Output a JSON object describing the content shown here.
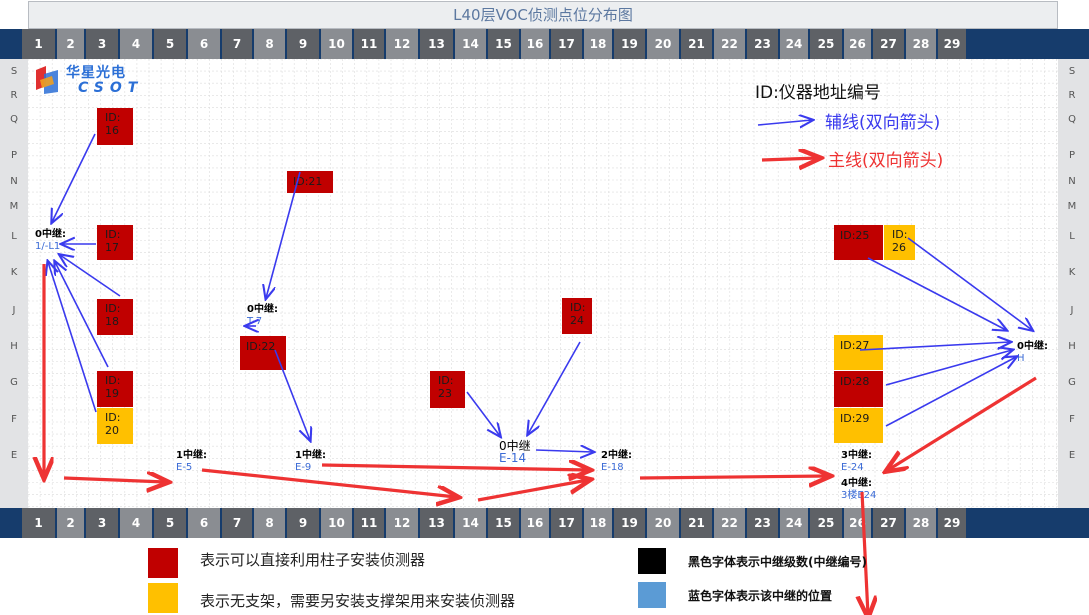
{
  "title": "L40层VOC侦测点位分布图",
  "columns": [
    "1",
    "2",
    "3",
    "4",
    "5",
    "6",
    "7",
    "8",
    "9",
    "10",
    "11",
    "12",
    "13",
    "14",
    "15",
    "16",
    "17",
    "18",
    "19",
    "20",
    "21",
    "22",
    "23",
    "24",
    "25",
    "26",
    "27",
    "28",
    "29"
  ],
  "rows": [
    "S",
    "R",
    "Q",
    "P",
    "N",
    "M",
    "L",
    "K",
    "J",
    "H",
    "G",
    "F",
    "E"
  ],
  "logo": {
    "text_cn": "华星光电",
    "text_en": "CSOT"
  },
  "legend_top": {
    "id_desc": "ID:仪器地址编号",
    "aux_line": "辅线(双向箭头)",
    "main_line": "主线(双向箭头)"
  },
  "detectors": [
    {
      "id_label": "ID:",
      "num": "16",
      "type": "red"
    },
    {
      "id_label": "ID:21",
      "num": "",
      "type": "red"
    },
    {
      "id_label": "ID:",
      "num": "17",
      "type": "red"
    },
    {
      "id_label": "ID:",
      "num": "18",
      "type": "red"
    },
    {
      "id_label": "ID:22",
      "num": "",
      "type": "red"
    },
    {
      "id_label": "ID:",
      "num": "24",
      "type": "red"
    },
    {
      "id_label": "ID:",
      "num": "19",
      "type": "red"
    },
    {
      "id_label": "ID:",
      "num": "23",
      "type": "red"
    },
    {
      "id_label": "ID:",
      "num": "20",
      "type": "yellow"
    },
    {
      "id_label": "ID:25",
      "num": "",
      "type": "red"
    },
    {
      "id_label": "ID:",
      "num": "26",
      "type": "yellow"
    },
    {
      "id_label": "ID:27",
      "num": "",
      "type": "yellow"
    },
    {
      "id_label": "ID:28",
      "num": "",
      "type": "red"
    },
    {
      "id_label": "ID:29",
      "num": "",
      "type": "yellow"
    }
  ],
  "relays": [
    {
      "level": "0中继:",
      "location": "1/-L1"
    },
    {
      "level": "0中继:",
      "location": "T-7"
    },
    {
      "level": "0中继:",
      "location": "H"
    },
    {
      "level": "1中继:",
      "location": "E-5"
    },
    {
      "level": "1中继:",
      "location": "E-9"
    },
    {
      "level": "0中继",
      "location": "E-14"
    },
    {
      "level": "2中继:",
      "location": "E-18"
    },
    {
      "level": "3中继:",
      "location": "E-24"
    },
    {
      "level": "4中继:",
      "location": "3楼E24"
    }
  ],
  "legend_bottom": {
    "red_desc": "表示可以直接利用柱子安装侦测器",
    "yellow_desc": "表示无支架，需要另安装支撑架用来安装侦测器",
    "black_desc": "黑色字体表示中继级数(中继编号)",
    "blue_desc": "蓝色字体表示该中继的位置"
  },
  "colors": {
    "red": "#c00000",
    "yellow": "#ffc000",
    "aux_arrow": "#3a3aee",
    "main_arrow": "#ee3333",
    "axis_navy": "#163c6c",
    "legend_black": "#000000",
    "legend_blue": "#5b9bd5"
  }
}
